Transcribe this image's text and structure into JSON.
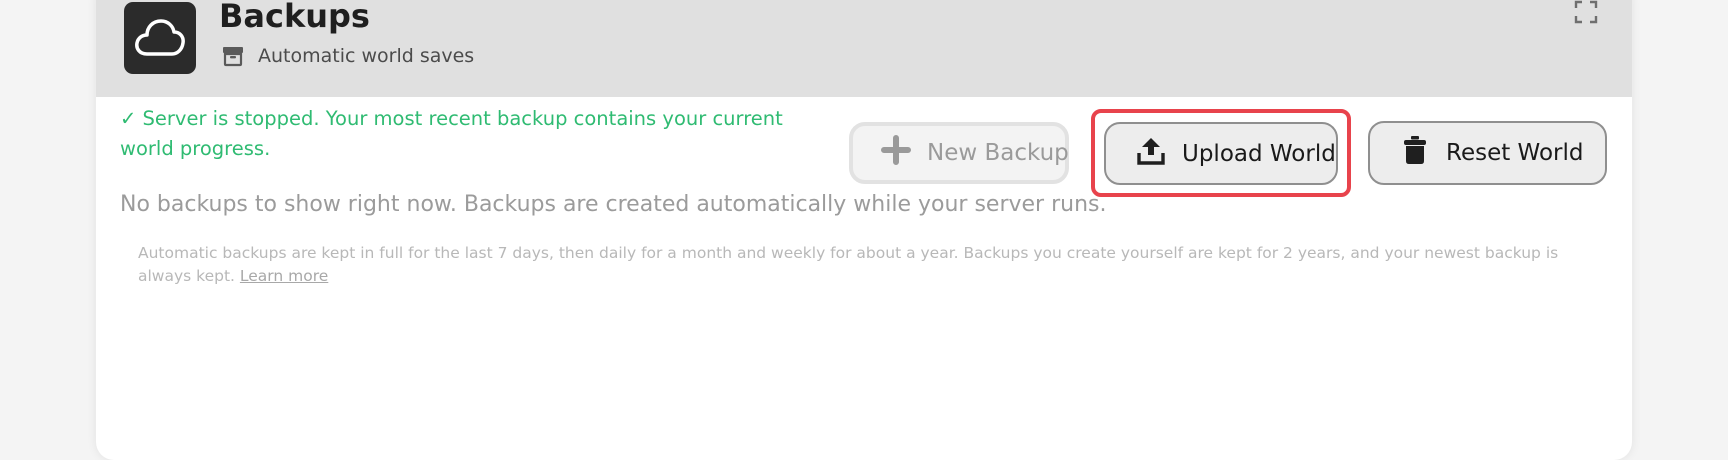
{
  "header": {
    "title": "Backups",
    "subtitle": "Automatic world saves",
    "app_icon": "cloud-icon",
    "subtitle_icon": "archive-icon"
  },
  "status_message": "✓ Server is stopped. Your most recent backup contains your current world progress.",
  "actions": {
    "new_backup": "New Backup",
    "upload_world": "Upload World",
    "reset_world": "Reset World"
  },
  "empty_message": "No backups to show right now. Backups are created automatically while your server runs.",
  "policy": {
    "text": "Automatic backups are kept in full for the last 7 days, then daily for a month and weekly for about a year. Backups you create yourself are kept for 2 years, and your newest backup is always kept.",
    "link": "Learn more"
  },
  "colors": {
    "status": "#2fbb72",
    "highlight": "#e8434c",
    "header_bg": "#e0e0e0"
  }
}
